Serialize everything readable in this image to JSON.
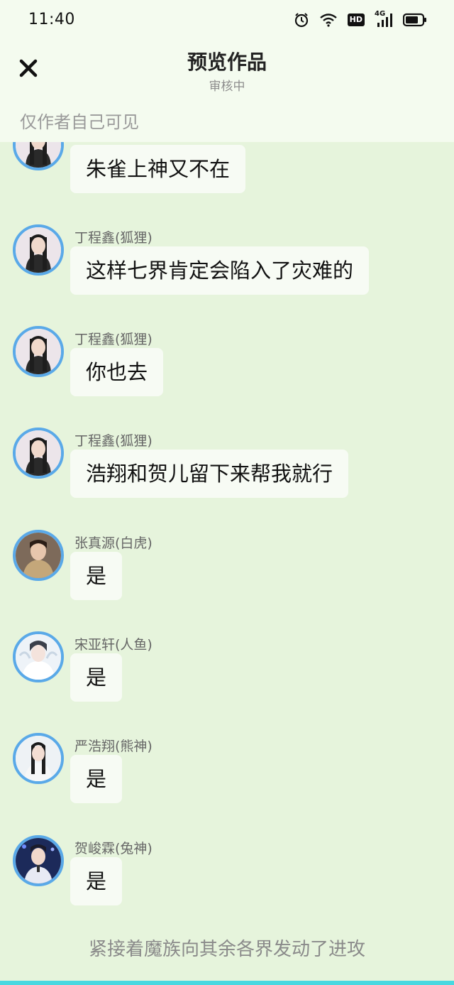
{
  "status_bar": {
    "time": "11:40",
    "icons": [
      "alarm-icon",
      "wifi-icon",
      "hd-icon",
      "4g-signal-icon",
      "battery-icon"
    ],
    "hd_label": "HD",
    "network_label": "4G"
  },
  "header": {
    "title": "预览作品",
    "subtitle": "审核中",
    "visibility_note": "仅作者自己可见",
    "close_icon": "close-icon"
  },
  "colors": {
    "chat_background": "#e6f4dc",
    "header_background": "#f4fbef",
    "avatar_border": "#5aa9e8",
    "bubble_background": "#f7fbf4",
    "bottom_bar": "#48d8e0"
  },
  "messages": [
    {
      "sender": "",
      "text": "朱雀上神又不在",
      "avatar": "avatar-dingchengxin"
    },
    {
      "sender": "丁程鑫(狐狸)",
      "text": "这样七界肯定会陷入了灾难的",
      "avatar": "avatar-dingchengxin"
    },
    {
      "sender": "丁程鑫(狐狸)",
      "text": "你也去",
      "avatar": "avatar-dingchengxin"
    },
    {
      "sender": "丁程鑫(狐狸)",
      "text": "浩翔和贺儿留下来帮我就行",
      "avatar": "avatar-dingchengxin"
    },
    {
      "sender": "张真源(白虎)",
      "text": "是",
      "avatar": "avatar-zhangzhenyuan"
    },
    {
      "sender": "宋亚轩(人鱼)",
      "text": "是",
      "avatar": "avatar-songyaxuan"
    },
    {
      "sender": "严浩翔(熊神)",
      "text": "是",
      "avatar": "avatar-yanhaoxiang"
    },
    {
      "sender": "贺峻霖(兔神)",
      "text": "是",
      "avatar": "avatar-hejunlin"
    }
  ],
  "narration": "紧接着魔族向其余各界发动了进攻"
}
